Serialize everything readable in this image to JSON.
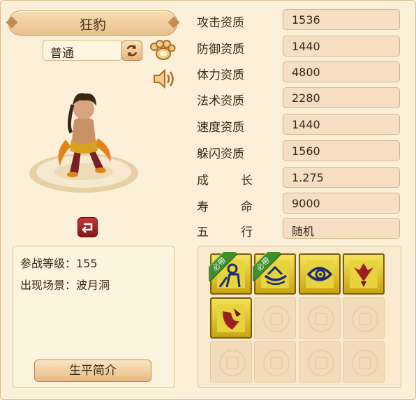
{
  "pet": {
    "name": "狂豹",
    "variant": "普通"
  },
  "info": {
    "level_label": "参战等级：",
    "level_value": "155",
    "scene_label": "出现场景：",
    "scene_value": "波月洞",
    "bio_button": "生平简介"
  },
  "stats": [
    {
      "label": "攻击资质",
      "value": "1536"
    },
    {
      "label": "防御资质",
      "value": "1440"
    },
    {
      "label": "体力资质",
      "value": "4800"
    },
    {
      "label": "法术资质",
      "value": "2280"
    },
    {
      "label": "速度资质",
      "value": "1440"
    },
    {
      "label": "躲闪资质",
      "value": "1560"
    },
    {
      "label_a": "成",
      "label_b": "长",
      "value": "1.275"
    },
    {
      "label_a": "寿",
      "label_b": "命",
      "value": "9000"
    },
    {
      "label_a": "五",
      "label_b": "行",
      "value": "随机"
    }
  ],
  "skills": {
    "must_have_tag": "必带",
    "slots": [
      {
        "icon": "skill-figure-icon",
        "must_have": true
      },
      {
        "icon": "skill-boat-icon",
        "must_have": true
      },
      {
        "icon": "skill-eye-icon",
        "must_have": false
      },
      {
        "icon": "skill-eagle-icon",
        "must_have": false
      },
      {
        "icon": "skill-shield-icon",
        "must_have": false
      }
    ]
  },
  "colors": {
    "panel_bg": "#fcf1d8",
    "skill_gold": "#e6cd35",
    "must_have_green": "#3f8f2a",
    "rotate_red": "#a32222"
  }
}
